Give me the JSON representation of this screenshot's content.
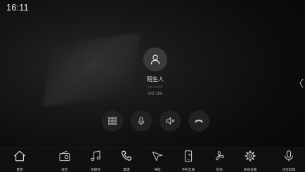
{
  "status_bar": {
    "time": "16:11"
  },
  "call": {
    "caller_name": "陌生人",
    "caller_number": "•• ••••",
    "duration": "00:08"
  },
  "controls": [
    {
      "icon": "keypad-icon"
    },
    {
      "icon": "microphone-icon"
    },
    {
      "icon": "speaker-icon"
    },
    {
      "icon": "hang-up-icon"
    }
  ],
  "nav": {
    "items": [
      {
        "label": "首页",
        "icon": "home-icon"
      },
      {
        "label": "收音",
        "icon": "radio-icon"
      },
      {
        "label": "多媒体",
        "icon": "music-note-icon"
      },
      {
        "label": "电话",
        "icon": "phone-icon",
        "active": true
      },
      {
        "label": "导航",
        "icon": "navigation-arrow-icon"
      },
      {
        "label": "手机互联",
        "icon": "phone-link-icon"
      },
      {
        "label": "空调",
        "icon": "fan-icon"
      },
      {
        "label": "系统设置",
        "icon": "gear-icon"
      },
      {
        "label": "语音助理",
        "icon": "voice-mic-icon"
      }
    ]
  },
  "colors": {
    "background": "#0c0c0c",
    "button_bg": "#222222",
    "hangup_icon": "#c9c9c9",
    "nav_bg": "#101010",
    "text_primary": "#e8e8e8",
    "text_muted": "#8e8e8e"
  }
}
